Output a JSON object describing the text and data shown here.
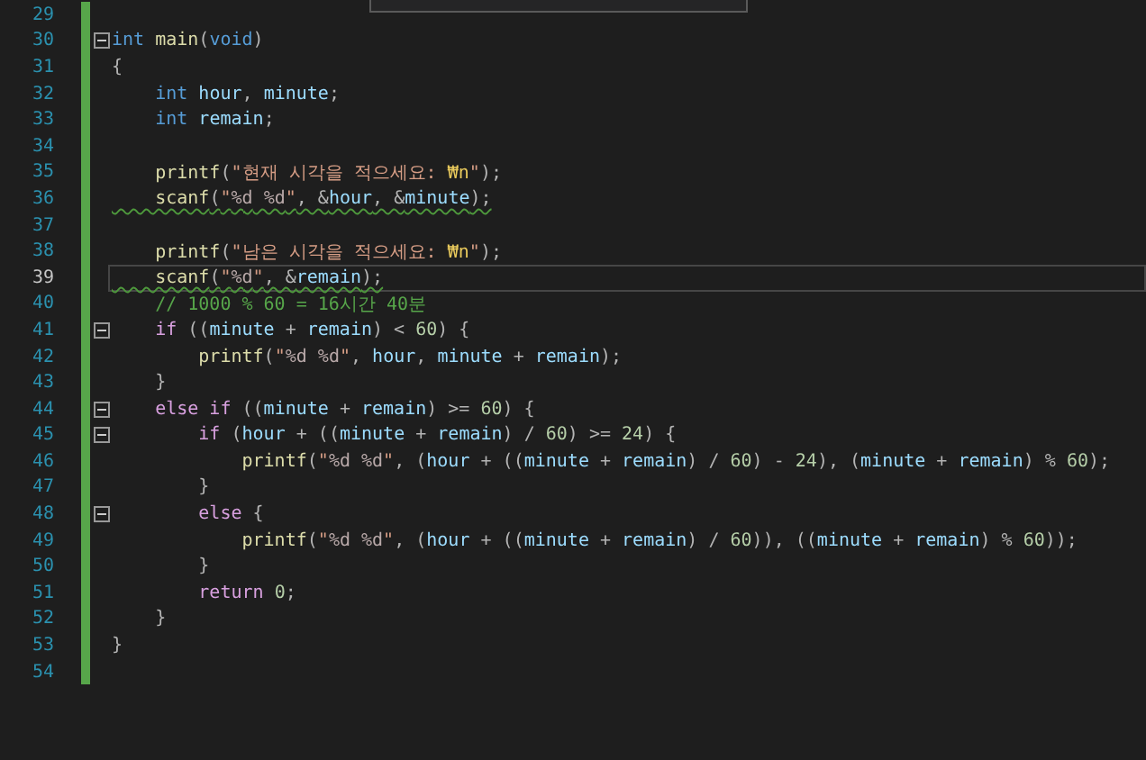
{
  "editor": {
    "lines": [
      {
        "number": "29"
      },
      {
        "number": "30",
        "foldable": true,
        "tokens": [
          {
            "kind": "keyword",
            "text": "int"
          },
          {
            "kind": "function",
            "text": " main"
          },
          {
            "kind": "punct",
            "text": "("
          },
          {
            "kind": "keyword",
            "text": "void"
          },
          {
            "kind": "punct",
            "text": ")"
          }
        ]
      },
      {
        "number": "31",
        "tokens": [
          {
            "kind": "punct",
            "text": "{"
          }
        ]
      },
      {
        "number": "32",
        "tokens": [
          {
            "kind": "keyword",
            "text": "    int"
          },
          {
            "kind": "variable",
            "text": " hour"
          },
          {
            "kind": "punct",
            "text": ", "
          },
          {
            "kind": "variable",
            "text": "minute"
          },
          {
            "kind": "punct",
            "text": ";"
          }
        ]
      },
      {
        "number": "33",
        "tokens": [
          {
            "kind": "keyword",
            "text": "    int"
          },
          {
            "kind": "variable",
            "text": " remain"
          },
          {
            "kind": "punct",
            "text": ";"
          }
        ]
      },
      {
        "number": "34"
      },
      {
        "number": "35",
        "tokens": [
          {
            "kind": "function",
            "text": "    printf"
          },
          {
            "kind": "punct",
            "text": "("
          },
          {
            "kind": "string",
            "text": "\"현재 시각을 적으세요: "
          },
          {
            "kind": "escape",
            "text": "₩n"
          },
          {
            "kind": "string",
            "text": "\""
          },
          {
            "kind": "punct",
            "text": ");"
          }
        ]
      },
      {
        "number": "36",
        "squiggly": true,
        "tokens": [
          {
            "kind": "function",
            "text": "    scanf"
          },
          {
            "kind": "punct",
            "text": "("
          },
          {
            "kind": "string",
            "text": "\""
          },
          {
            "kind": "format",
            "text": "%d"
          },
          {
            "kind": "format",
            "text": " %d"
          },
          {
            "kind": "string",
            "text": "\""
          },
          {
            "kind": "punct",
            "text": ", &"
          },
          {
            "kind": "variable",
            "text": "hour"
          },
          {
            "kind": "punct",
            "text": ", &"
          },
          {
            "kind": "variable",
            "text": "minute"
          },
          {
            "kind": "punct",
            "text": ");"
          }
        ]
      },
      {
        "number": "37"
      },
      {
        "number": "38",
        "tokens": [
          {
            "kind": "function",
            "text": "    printf"
          },
          {
            "kind": "punct",
            "text": "("
          },
          {
            "kind": "string",
            "text": "\"남은 시각을 적으세요: "
          },
          {
            "kind": "escape",
            "text": "₩n"
          },
          {
            "kind": "string",
            "text": "\""
          },
          {
            "kind": "punct",
            "text": ");"
          }
        ]
      },
      {
        "number": "39",
        "current": true,
        "squiggly": true,
        "tokens": [
          {
            "kind": "function",
            "text": "    scanf"
          },
          {
            "kind": "punct",
            "text": "("
          },
          {
            "kind": "string",
            "text": "\""
          },
          {
            "kind": "format",
            "text": "%d"
          },
          {
            "kind": "string",
            "text": "\""
          },
          {
            "kind": "punct",
            "text": ", &"
          },
          {
            "kind": "variable",
            "text": "remain"
          },
          {
            "kind": "punct",
            "text": ");"
          }
        ]
      },
      {
        "number": "40",
        "tokens": [
          {
            "kind": "comment",
            "text": "    // 1000 % 60 = 16시간 40분"
          }
        ]
      },
      {
        "number": "41",
        "foldable": true,
        "tokens": [
          {
            "kind": "control",
            "text": "    if"
          },
          {
            "kind": "punct",
            "text": " (("
          },
          {
            "kind": "variable",
            "text": "minute"
          },
          {
            "kind": "punct",
            "text": " + "
          },
          {
            "kind": "variable",
            "text": "remain"
          },
          {
            "kind": "punct",
            "text": ") < "
          },
          {
            "kind": "number",
            "text": "60"
          },
          {
            "kind": "punct",
            "text": ") {"
          }
        ]
      },
      {
        "number": "42",
        "tokens": [
          {
            "kind": "function",
            "text": "        printf"
          },
          {
            "kind": "punct",
            "text": "("
          },
          {
            "kind": "string",
            "text": "\""
          },
          {
            "kind": "format",
            "text": "%d"
          },
          {
            "kind": "format",
            "text": " %d"
          },
          {
            "kind": "string",
            "text": "\""
          },
          {
            "kind": "punct",
            "text": ", "
          },
          {
            "kind": "variable",
            "text": "hour"
          },
          {
            "kind": "punct",
            "text": ", "
          },
          {
            "kind": "variable",
            "text": "minute"
          },
          {
            "kind": "punct",
            "text": " + "
          },
          {
            "kind": "variable",
            "text": "remain"
          },
          {
            "kind": "punct",
            "text": ");"
          }
        ]
      },
      {
        "number": "43",
        "tokens": [
          {
            "kind": "punct",
            "text": "    }"
          }
        ]
      },
      {
        "number": "44",
        "foldable": true,
        "tokens": [
          {
            "kind": "control",
            "text": "    else if"
          },
          {
            "kind": "punct",
            "text": " (("
          },
          {
            "kind": "variable",
            "text": "minute"
          },
          {
            "kind": "punct",
            "text": " + "
          },
          {
            "kind": "variable",
            "text": "remain"
          },
          {
            "kind": "punct",
            "text": ") >= "
          },
          {
            "kind": "number",
            "text": "60"
          },
          {
            "kind": "punct",
            "text": ") {"
          }
        ]
      },
      {
        "number": "45",
        "foldable": true,
        "tokens": [
          {
            "kind": "control",
            "text": "        if"
          },
          {
            "kind": "punct",
            "text": " ("
          },
          {
            "kind": "variable",
            "text": "hour"
          },
          {
            "kind": "punct",
            "text": " + (("
          },
          {
            "kind": "variable",
            "text": "minute"
          },
          {
            "kind": "punct",
            "text": " + "
          },
          {
            "kind": "variable",
            "text": "remain"
          },
          {
            "kind": "punct",
            "text": ") / "
          },
          {
            "kind": "number",
            "text": "60"
          },
          {
            "kind": "punct",
            "text": ") >= "
          },
          {
            "kind": "number",
            "text": "24"
          },
          {
            "kind": "punct",
            "text": ") {"
          }
        ]
      },
      {
        "number": "46",
        "tokens": [
          {
            "kind": "function",
            "text": "            printf"
          },
          {
            "kind": "punct",
            "text": "("
          },
          {
            "kind": "string",
            "text": "\""
          },
          {
            "kind": "format",
            "text": "%d"
          },
          {
            "kind": "format",
            "text": " %d"
          },
          {
            "kind": "string",
            "text": "\""
          },
          {
            "kind": "punct",
            "text": ", ("
          },
          {
            "kind": "variable",
            "text": "hour"
          },
          {
            "kind": "punct",
            "text": " + (("
          },
          {
            "kind": "variable",
            "text": "minute"
          },
          {
            "kind": "punct",
            "text": " + "
          },
          {
            "kind": "variable",
            "text": "remain"
          },
          {
            "kind": "punct",
            "text": ") / "
          },
          {
            "kind": "number",
            "text": "60"
          },
          {
            "kind": "punct",
            "text": ") - "
          },
          {
            "kind": "number",
            "text": "24"
          },
          {
            "kind": "punct",
            "text": "), ("
          },
          {
            "kind": "variable",
            "text": "minute"
          },
          {
            "kind": "punct",
            "text": " + "
          },
          {
            "kind": "variable",
            "text": "remain"
          },
          {
            "kind": "punct",
            "text": ") % "
          },
          {
            "kind": "number",
            "text": "60"
          },
          {
            "kind": "punct",
            "text": ");"
          }
        ]
      },
      {
        "number": "47",
        "tokens": [
          {
            "kind": "punct",
            "text": "        }"
          }
        ]
      },
      {
        "number": "48",
        "foldable": true,
        "tokens": [
          {
            "kind": "control",
            "text": "        else"
          },
          {
            "kind": "punct",
            "text": " {"
          }
        ]
      },
      {
        "number": "49",
        "tokens": [
          {
            "kind": "function",
            "text": "            printf"
          },
          {
            "kind": "punct",
            "text": "("
          },
          {
            "kind": "string",
            "text": "\""
          },
          {
            "kind": "format",
            "text": "%d"
          },
          {
            "kind": "format",
            "text": " %d"
          },
          {
            "kind": "string",
            "text": "\""
          },
          {
            "kind": "punct",
            "text": ", ("
          },
          {
            "kind": "variable",
            "text": "hour"
          },
          {
            "kind": "punct",
            "text": " + (("
          },
          {
            "kind": "variable",
            "text": "minute"
          },
          {
            "kind": "punct",
            "text": " + "
          },
          {
            "kind": "variable",
            "text": "remain"
          },
          {
            "kind": "punct",
            "text": ") / "
          },
          {
            "kind": "number",
            "text": "60"
          },
          {
            "kind": "punct",
            "text": ")), (("
          },
          {
            "kind": "variable",
            "text": "minute"
          },
          {
            "kind": "punct",
            "text": " + "
          },
          {
            "kind": "variable",
            "text": "remain"
          },
          {
            "kind": "punct",
            "text": ") % "
          },
          {
            "kind": "number",
            "text": "60"
          },
          {
            "kind": "punct",
            "text": "));"
          }
        ]
      },
      {
        "number": "50",
        "tokens": [
          {
            "kind": "punct",
            "text": "        }"
          }
        ]
      },
      {
        "number": "51",
        "tokens": [
          {
            "kind": "control",
            "text": "        return"
          },
          {
            "kind": "number",
            "text": " 0"
          },
          {
            "kind": "punct",
            "text": ";"
          }
        ]
      },
      {
        "number": "52",
        "tokens": [
          {
            "kind": "punct",
            "text": "    }"
          }
        ]
      },
      {
        "number": "53",
        "tokens": [
          {
            "kind": "punct",
            "text": "}"
          }
        ]
      },
      {
        "number": "54"
      }
    ]
  }
}
